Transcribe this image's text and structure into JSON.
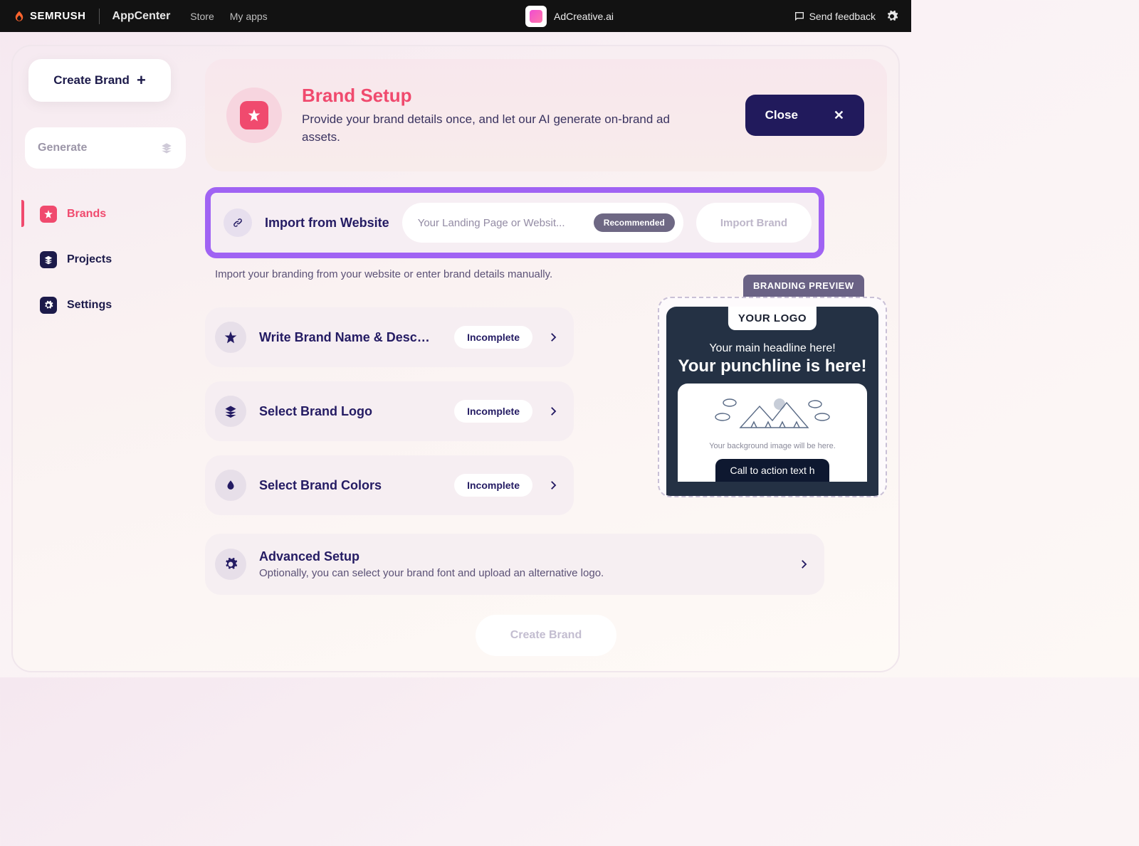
{
  "topbar": {
    "brand": "SEMRUSH",
    "appcenter": "AppCenter",
    "nav": {
      "store": "Store",
      "myapps": "My apps"
    },
    "app_name": "AdCreative.ai",
    "feedback": "Send feedback"
  },
  "sidebar": {
    "create_brand": "Create Brand",
    "generate": "Generate",
    "items": {
      "brands": "Brands",
      "projects": "Projects",
      "settings": "Settings"
    }
  },
  "hero": {
    "title": "Brand Setup",
    "subtitle": "Provide your brand details once, and let our AI generate on-brand ad assets.",
    "close": "Close"
  },
  "import": {
    "title": "Import from Website",
    "placeholder": "Your Landing Page or Websit...",
    "badge": "Recommended",
    "button": "Import Brand",
    "helper": "Import your branding from your website or enter brand details manually."
  },
  "steps": {
    "name": {
      "title": "Write Brand Name & Desc…",
      "status": "Incomplete"
    },
    "logo": {
      "title": "Select Brand Logo",
      "status": "Incomplete"
    },
    "colors": {
      "title": "Select Brand Colors",
      "status": "Incomplete"
    }
  },
  "advanced": {
    "title": "Advanced Setup",
    "subtitle": "Optionally, you can select your brand font and upload an alternative logo."
  },
  "cta": "Create Brand",
  "preview": {
    "badge": "BRANDING PREVIEW",
    "logo": "YOUR LOGO",
    "headline": "Your main headline here!",
    "punchline": "Your punchline is here!",
    "bg_text": "Your background image will be here.",
    "cta_text": "Call to action text h"
  }
}
